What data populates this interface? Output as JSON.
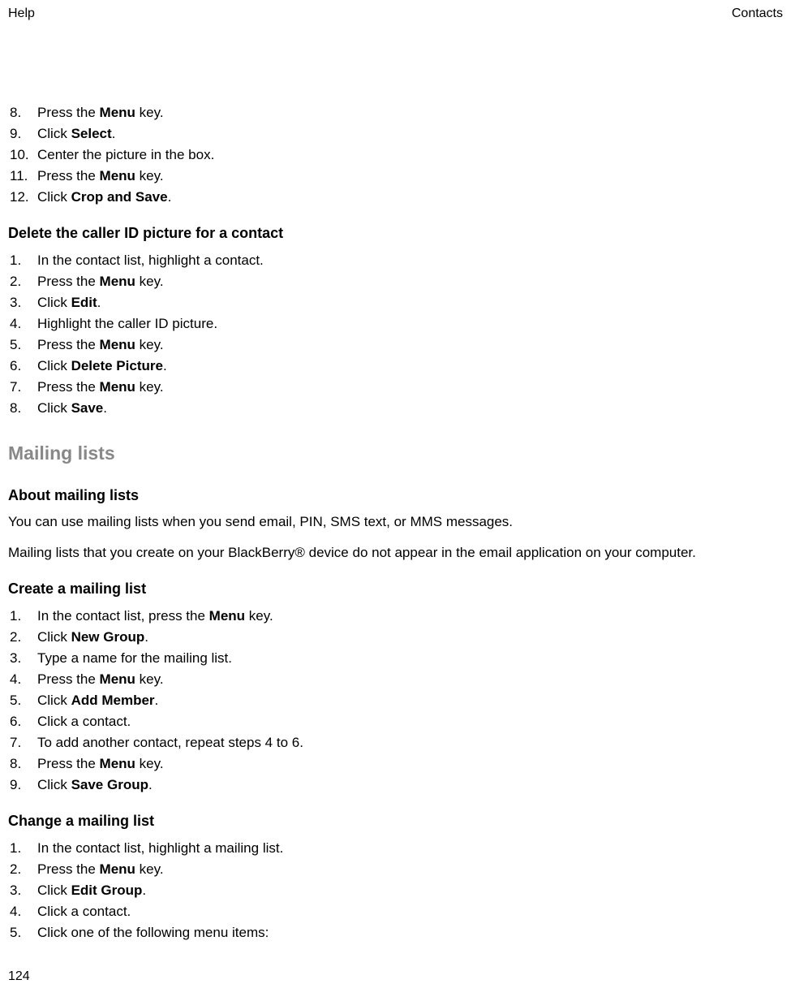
{
  "header": {
    "left": "Help",
    "right": "Contacts"
  },
  "list1": {
    "items": [
      {
        "n": "8.",
        "pre": "Press the ",
        "bold": "Menu",
        "post": " key."
      },
      {
        "n": "9.",
        "pre": "Click ",
        "bold": "Select",
        "post": "."
      },
      {
        "n": "10.",
        "pre": "Center the picture in the box.",
        "bold": "",
        "post": ""
      },
      {
        "n": "11.",
        "pre": "Press the ",
        "bold": "Menu",
        "post": " key."
      },
      {
        "n": "12.",
        "pre": "Click ",
        "bold": "Crop and Save",
        "post": "."
      }
    ]
  },
  "h2a": "Delete the caller ID picture for a contact",
  "list2": {
    "items": [
      {
        "n": "1.",
        "pre": "In the contact list, highlight a contact.",
        "bold": "",
        "post": ""
      },
      {
        "n": "2.",
        "pre": "Press the ",
        "bold": "Menu",
        "post": " key."
      },
      {
        "n": "3.",
        "pre": "Click ",
        "bold": "Edit",
        "post": "."
      },
      {
        "n": "4.",
        "pre": "Highlight the caller ID picture.",
        "bold": "",
        "post": ""
      },
      {
        "n": "5.",
        "pre": "Press the ",
        "bold": "Menu",
        "post": " key."
      },
      {
        "n": "6.",
        "pre": "Click ",
        "bold": "Delete Picture",
        "post": "."
      },
      {
        "n": "7.",
        "pre": "Press the ",
        "bold": "Menu",
        "post": " key."
      },
      {
        "n": "8.",
        "pre": "Click ",
        "bold": "Save",
        "post": "."
      }
    ]
  },
  "h1": "Mailing lists",
  "h3a": "About mailing lists",
  "p1": "You can use mailing lists when you send email, PIN, SMS text, or MMS messages.",
  "p2": "Mailing lists that you create on your BlackBerry® device do not appear in the email application on your computer.",
  "h2b": "Create a mailing list",
  "list3": {
    "items": [
      {
        "n": "1.",
        "pre": "In the contact list, press the ",
        "bold": "Menu",
        "post": " key."
      },
      {
        "n": "2.",
        "pre": "Click ",
        "bold": "New Group",
        "post": "."
      },
      {
        "n": "3.",
        "pre": "Type a name for the mailing list.",
        "bold": "",
        "post": ""
      },
      {
        "n": "4.",
        "pre": "Press the ",
        "bold": "Menu",
        "post": " key."
      },
      {
        "n": "5.",
        "pre": "Click ",
        "bold": "Add Member",
        "post": "."
      },
      {
        "n": "6.",
        "pre": "Click a contact.",
        "bold": "",
        "post": ""
      },
      {
        "n": "7.",
        "pre": "To add another contact, repeat steps 4 to 6.",
        "bold": "",
        "post": ""
      },
      {
        "n": "8.",
        "pre": "Press the ",
        "bold": "Menu",
        "post": " key."
      },
      {
        "n": "9.",
        "pre": "Click ",
        "bold": "Save Group",
        "post": "."
      }
    ]
  },
  "h2c": "Change a mailing list",
  "list4": {
    "items": [
      {
        "n": "1.",
        "pre": "In the contact list, highlight a mailing list.",
        "bold": "",
        "post": ""
      },
      {
        "n": "2.",
        "pre": "Press the ",
        "bold": "Menu",
        "post": " key."
      },
      {
        "n": "3.",
        "pre": "Click ",
        "bold": "Edit Group",
        "post": "."
      },
      {
        "n": "4.",
        "pre": "Click a contact.",
        "bold": "",
        "post": ""
      },
      {
        "n": "5.",
        "pre": "Click one of the following menu items:",
        "bold": "",
        "post": ""
      }
    ]
  },
  "page_number": "124"
}
